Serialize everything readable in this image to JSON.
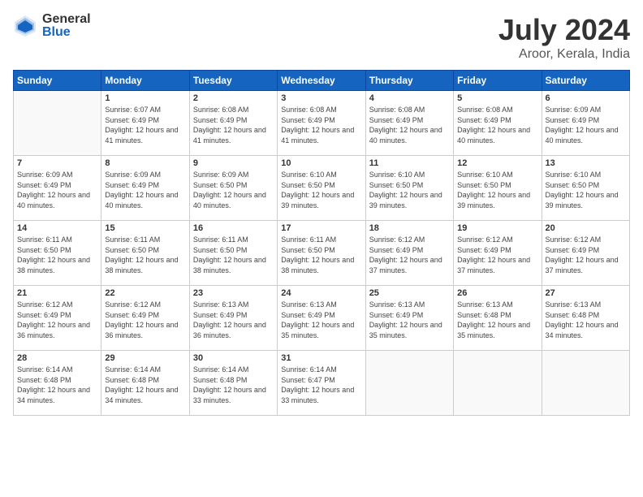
{
  "header": {
    "logo_general": "General",
    "logo_blue": "Blue",
    "title": "July 2024",
    "subtitle": "Aroor, Kerala, India"
  },
  "calendar": {
    "days_of_week": [
      "Sunday",
      "Monday",
      "Tuesday",
      "Wednesday",
      "Thursday",
      "Friday",
      "Saturday"
    ],
    "weeks": [
      [
        {
          "day": "",
          "sunrise": "",
          "sunset": "",
          "daylight": ""
        },
        {
          "day": "1",
          "sunrise": "Sunrise: 6:07 AM",
          "sunset": "Sunset: 6:49 PM",
          "daylight": "Daylight: 12 hours and 41 minutes."
        },
        {
          "day": "2",
          "sunrise": "Sunrise: 6:08 AM",
          "sunset": "Sunset: 6:49 PM",
          "daylight": "Daylight: 12 hours and 41 minutes."
        },
        {
          "day": "3",
          "sunrise": "Sunrise: 6:08 AM",
          "sunset": "Sunset: 6:49 PM",
          "daylight": "Daylight: 12 hours and 41 minutes."
        },
        {
          "day": "4",
          "sunrise": "Sunrise: 6:08 AM",
          "sunset": "Sunset: 6:49 PM",
          "daylight": "Daylight: 12 hours and 40 minutes."
        },
        {
          "day": "5",
          "sunrise": "Sunrise: 6:08 AM",
          "sunset": "Sunset: 6:49 PM",
          "daylight": "Daylight: 12 hours and 40 minutes."
        },
        {
          "day": "6",
          "sunrise": "Sunrise: 6:09 AM",
          "sunset": "Sunset: 6:49 PM",
          "daylight": "Daylight: 12 hours and 40 minutes."
        }
      ],
      [
        {
          "day": "7",
          "sunrise": "Sunrise: 6:09 AM",
          "sunset": "Sunset: 6:49 PM",
          "daylight": "Daylight: 12 hours and 40 minutes."
        },
        {
          "day": "8",
          "sunrise": "Sunrise: 6:09 AM",
          "sunset": "Sunset: 6:49 PM",
          "daylight": "Daylight: 12 hours and 40 minutes."
        },
        {
          "day": "9",
          "sunrise": "Sunrise: 6:09 AM",
          "sunset": "Sunset: 6:50 PM",
          "daylight": "Daylight: 12 hours and 40 minutes."
        },
        {
          "day": "10",
          "sunrise": "Sunrise: 6:10 AM",
          "sunset": "Sunset: 6:50 PM",
          "daylight": "Daylight: 12 hours and 39 minutes."
        },
        {
          "day": "11",
          "sunrise": "Sunrise: 6:10 AM",
          "sunset": "Sunset: 6:50 PM",
          "daylight": "Daylight: 12 hours and 39 minutes."
        },
        {
          "day": "12",
          "sunrise": "Sunrise: 6:10 AM",
          "sunset": "Sunset: 6:50 PM",
          "daylight": "Daylight: 12 hours and 39 minutes."
        },
        {
          "day": "13",
          "sunrise": "Sunrise: 6:10 AM",
          "sunset": "Sunset: 6:50 PM",
          "daylight": "Daylight: 12 hours and 39 minutes."
        }
      ],
      [
        {
          "day": "14",
          "sunrise": "Sunrise: 6:11 AM",
          "sunset": "Sunset: 6:50 PM",
          "daylight": "Daylight: 12 hours and 38 minutes."
        },
        {
          "day": "15",
          "sunrise": "Sunrise: 6:11 AM",
          "sunset": "Sunset: 6:50 PM",
          "daylight": "Daylight: 12 hours and 38 minutes."
        },
        {
          "day": "16",
          "sunrise": "Sunrise: 6:11 AM",
          "sunset": "Sunset: 6:50 PM",
          "daylight": "Daylight: 12 hours and 38 minutes."
        },
        {
          "day": "17",
          "sunrise": "Sunrise: 6:11 AM",
          "sunset": "Sunset: 6:50 PM",
          "daylight": "Daylight: 12 hours and 38 minutes."
        },
        {
          "day": "18",
          "sunrise": "Sunrise: 6:12 AM",
          "sunset": "Sunset: 6:49 PM",
          "daylight": "Daylight: 12 hours and 37 minutes."
        },
        {
          "day": "19",
          "sunrise": "Sunrise: 6:12 AM",
          "sunset": "Sunset: 6:49 PM",
          "daylight": "Daylight: 12 hours and 37 minutes."
        },
        {
          "day": "20",
          "sunrise": "Sunrise: 6:12 AM",
          "sunset": "Sunset: 6:49 PM",
          "daylight": "Daylight: 12 hours and 37 minutes."
        }
      ],
      [
        {
          "day": "21",
          "sunrise": "Sunrise: 6:12 AM",
          "sunset": "Sunset: 6:49 PM",
          "daylight": "Daylight: 12 hours and 36 minutes."
        },
        {
          "day": "22",
          "sunrise": "Sunrise: 6:12 AM",
          "sunset": "Sunset: 6:49 PM",
          "daylight": "Daylight: 12 hours and 36 minutes."
        },
        {
          "day": "23",
          "sunrise": "Sunrise: 6:13 AM",
          "sunset": "Sunset: 6:49 PM",
          "daylight": "Daylight: 12 hours and 36 minutes."
        },
        {
          "day": "24",
          "sunrise": "Sunrise: 6:13 AM",
          "sunset": "Sunset: 6:49 PM",
          "daylight": "Daylight: 12 hours and 35 minutes."
        },
        {
          "day": "25",
          "sunrise": "Sunrise: 6:13 AM",
          "sunset": "Sunset: 6:49 PM",
          "daylight": "Daylight: 12 hours and 35 minutes."
        },
        {
          "day": "26",
          "sunrise": "Sunrise: 6:13 AM",
          "sunset": "Sunset: 6:48 PM",
          "daylight": "Daylight: 12 hours and 35 minutes."
        },
        {
          "day": "27",
          "sunrise": "Sunrise: 6:13 AM",
          "sunset": "Sunset: 6:48 PM",
          "daylight": "Daylight: 12 hours and 34 minutes."
        }
      ],
      [
        {
          "day": "28",
          "sunrise": "Sunrise: 6:14 AM",
          "sunset": "Sunset: 6:48 PM",
          "daylight": "Daylight: 12 hours and 34 minutes."
        },
        {
          "day": "29",
          "sunrise": "Sunrise: 6:14 AM",
          "sunset": "Sunset: 6:48 PM",
          "daylight": "Daylight: 12 hours and 34 minutes."
        },
        {
          "day": "30",
          "sunrise": "Sunrise: 6:14 AM",
          "sunset": "Sunset: 6:48 PM",
          "daylight": "Daylight: 12 hours and 33 minutes."
        },
        {
          "day": "31",
          "sunrise": "Sunrise: 6:14 AM",
          "sunset": "Sunset: 6:47 PM",
          "daylight": "Daylight: 12 hours and 33 minutes."
        },
        {
          "day": "",
          "sunrise": "",
          "sunset": "",
          "daylight": ""
        },
        {
          "day": "",
          "sunrise": "",
          "sunset": "",
          "daylight": ""
        },
        {
          "day": "",
          "sunrise": "",
          "sunset": "",
          "daylight": ""
        }
      ]
    ]
  }
}
